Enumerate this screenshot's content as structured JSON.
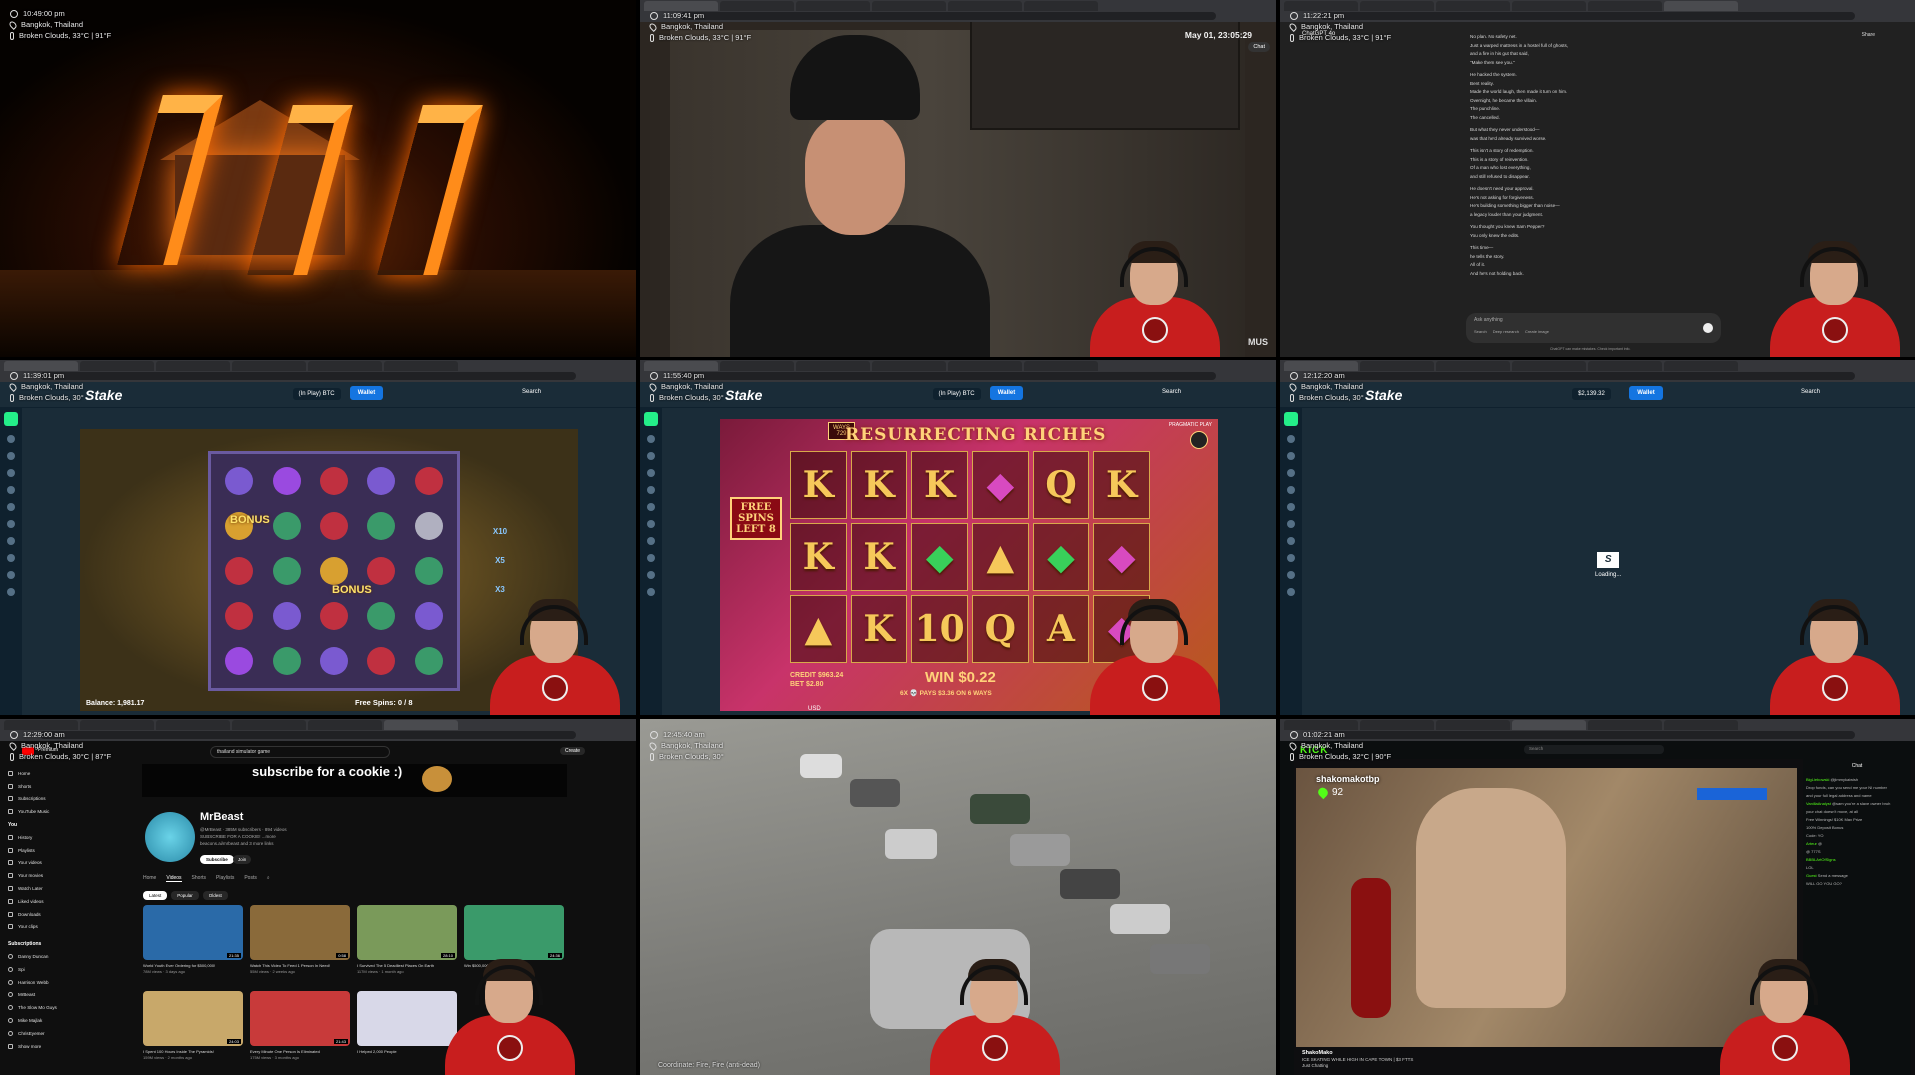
{
  "overlay": {
    "location": "Bangkok, Thailand",
    "weather": "Broken Clouds, 33°C | 91°F",
    "weather_short": "Broken Clouds, 30°",
    "weather_yt": "Broken Clouds, 30°C | 87°F",
    "weather_kick": "Broken Clouds, 32°C | 90°F",
    "times": [
      "10:49:00 pm",
      "11:09:41 pm",
      "11:22:21 pm",
      "11:39:01 pm",
      "11:55:40 pm",
      "12:12:20 am",
      "12:29:00 am",
      "12:45:40 am",
      "01:02:21 am"
    ]
  },
  "tile2": {
    "date": "May 01, 23:05:29",
    "chat_btn": "Chat",
    "watermark": "MUS"
  },
  "tile3": {
    "title": "ChatGPT 4o",
    "share": "Share",
    "lines": [
      "No plan. No safety net.",
      "Just a warped mattress in a hostel full of ghosts,",
      "and a fire in his gut that said,",
      "\"Make them see you.\"",
      "He hacked the system.",
      "Bent reality.",
      "Made the world laugh, then made it turn on him.",
      "Overnight, he became the villain.",
      "The punchline.",
      "The cancelled.",
      "But what they never understood—",
      "was that he'd already survived worse.",
      "This isn't a story of redemption.",
      "This is a story of reinvention.",
      "Of a man who lost everything,",
      "and still refused to disappear.",
      "He doesn't need your approval.",
      "He's not asking for forgiveness.",
      "He's building something bigger than noise—",
      "a legacy louder than your judgment.",
      "You thought you knew Sam Pepper?",
      "You only knew the edits.",
      "This time—",
      "he tells the story.",
      "All of it.",
      "And he's not holding back."
    ],
    "input_placeholder": "Ask anything",
    "tools": [
      "Search",
      "Deep research",
      "Create image"
    ],
    "disclaimer": "ChatGPT can make mistakes. Check important info."
  },
  "stake": {
    "logo": "Stake",
    "in_play": "(In Play)",
    "currency": "BTC",
    "wallet": "Wallet",
    "search": "Search",
    "balance_tile6": "$2,139.32",
    "loading": "Loading..."
  },
  "slot1": {
    "balance": "Balance: 1,981.17",
    "free_spins": "Free Spins: 0 / 8",
    "bonus": "BONUS",
    "multipliers": [
      "X10",
      "X5",
      "X3"
    ]
  },
  "slot2": {
    "title": "RESURRECTING RICHES",
    "ways_label": "WAYS",
    "ways": "729",
    "provider": "PRAGMATIC PLAY",
    "free_spins": "FREE SPINS LEFT 8",
    "symbols": [
      "K",
      "K",
      "K",
      "◆",
      "Q",
      "K",
      "K",
      "K",
      "◆",
      "▲",
      "◆",
      "◆",
      "▲",
      "K",
      "10",
      "Q",
      "A",
      "◆"
    ],
    "credit": "CREDIT $963.24",
    "bet": "BET $2.80",
    "win": "WIN $0.22",
    "pays": "6X 💀 PAYS $3.36 ON 6 WAYS",
    "usd": "USD"
  },
  "youtube": {
    "search": "thailand simulator game",
    "create": "Create",
    "premium": "Premium",
    "banner": "subscribe for a cookie :)",
    "channel": "MrBeast",
    "meta": "@MrBeast · 385M subscribers · 894 videos",
    "desc": "SUBSCRIBE FOR A COOKIE! ...more",
    "link": "beacons.ai/mrbeast and 3 more links",
    "subscribe": "Subscribe",
    "join": "Join",
    "tabs": [
      "Home",
      "Videos",
      "Shorts",
      "Playlists",
      "Posts"
    ],
    "chips": [
      "Latest",
      "Popular",
      "Oldest"
    ],
    "sidebar": [
      "Home",
      "Shorts",
      "Subscriptions",
      "YouTube Music"
    ],
    "you_label": "You",
    "you_items": [
      "History",
      "Playlists",
      "Your videos",
      "Your movies",
      "Watch Later",
      "Liked videos",
      "Downloads",
      "Your clips"
    ],
    "subs_label": "Subscriptions",
    "subs": [
      "Danny Duncan",
      "Spi",
      "Harrison Webb",
      "MrBeast",
      "The Slow Mo Guys",
      "Mike Majlak",
      "ChrisEyemer",
      "Show more"
    ],
    "videos": [
      {
        "title": "World Youth Ever Ordering for $500,000!",
        "meta": "78M views · 3 days ago",
        "dur": "21:35"
      },
      {
        "title": "Watch This Video To Feed 1 Person In Need!",
        "meta": "55M views · 2 weeks ago",
        "dur": "0:58"
      },
      {
        "title": "I Survived The 5 Deadliest Places On Earth",
        "meta": "117M views · 1 month ago",
        "dur": "28:10"
      },
      {
        "title": "Win $500,000",
        "meta": "",
        "dur": "24:36"
      },
      {
        "title": "I Spent 100 Hours Inside The Pyramids!",
        "meta": "159M views · 2 months ago",
        "dur": "24:03"
      },
      {
        "title": "Every Minute One Person Is Eliminated",
        "meta": "175M views · 3 months ago",
        "dur": "21:43"
      },
      {
        "title": "I Helped 2,000 People",
        "meta": "",
        "dur": ""
      }
    ]
  },
  "tile8": {
    "caption": "Coordinate: Fire, Fire (anti-dead)"
  },
  "kick": {
    "logo": "KICK",
    "search": "Search",
    "streamer": "shakomakotbp",
    "viewers": "92",
    "channel": "ShakoMako",
    "title": "ICE SKATING WHILE HIGH IN CAPE TOWN | $3 FTTS",
    "category": "Just Chatting",
    "chat_title": "Chat",
    "chat": [
      {
        "u": "BigLiebowski",
        "m": "@jimmykaiwish"
      },
      {
        "u": "",
        "m": "Drop funds, can you send me your NI number"
      },
      {
        "u": "",
        "m": "and your full legal address and name"
      },
      {
        "u": "VanillaAnalyst",
        "m": "@sam you're a slave owner bruh"
      },
      {
        "u": "",
        "m": "your chat doesn't move, at all"
      },
      {
        "u": "",
        "m": "Free Winnings! $10K Max Prize"
      },
      {
        "u": "",
        "m": "100% Deposit Bonus"
      },
      {
        "u": "",
        "m": "Code: YO"
      },
      {
        "u": "Arteur",
        "m": "@"
      },
      {
        "u": "",
        "m": "@ 777S"
      },
      {
        "u": "BBBLArtOfSigns",
        "m": ""
      },
      {
        "u": "",
        "m": "LOL"
      },
      {
        "u": "Guest",
        "m": "Send a message"
      },
      {
        "u": "",
        "m": "WILL GO YOU GO?"
      }
    ]
  }
}
